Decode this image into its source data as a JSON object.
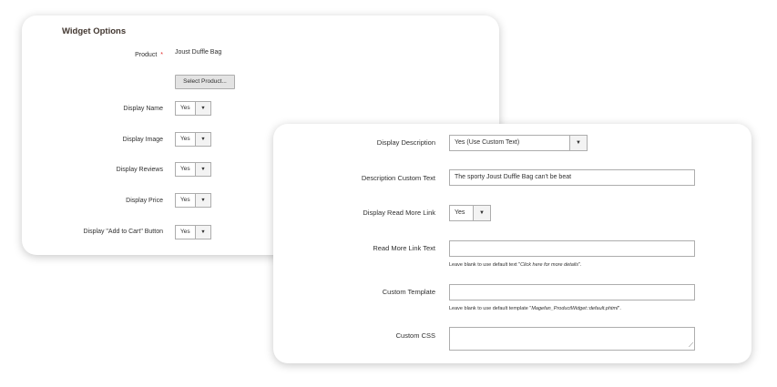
{
  "widget_options": {
    "section_title": "Widget Options",
    "product": {
      "label": "Product",
      "required_mark": "*",
      "value": "Joust Duffle Bag"
    },
    "select_product_button": "Select Product...",
    "display_name": {
      "label": "Display Name",
      "value": "Yes"
    },
    "display_image": {
      "label": "Display Image",
      "value": "Yes"
    },
    "display_reviews": {
      "label": "Display Reviews",
      "value": "Yes"
    },
    "display_price": {
      "label": "Display Price",
      "value": "Yes"
    },
    "display_add_to_cart": {
      "label": "Display \"Add to Cart\" Button",
      "value": "Yes"
    },
    "dropdown_icon": "chevron-down-icon"
  },
  "description_options": {
    "display_description": {
      "label": "Display Description",
      "value": "Yes (Use Custom Text)"
    },
    "description_custom_text": {
      "label": "Description Custom Text",
      "value": "The sporty Joust Duffle Bag can't be beat"
    },
    "display_read_more_link": {
      "label": "Display Read More Link",
      "value": "Yes"
    },
    "read_more_link_text": {
      "label": "Read More Link Text",
      "value": "",
      "note_prefix": "Leave blank to use default text \"",
      "note_default": "Click here for more details",
      "note_suffix": "\"."
    },
    "custom_template": {
      "label": "Custom Template",
      "value": "",
      "note_prefix": "Leave blank to use default template \"",
      "note_default": "Magefan_ProductWidget::default.phtml",
      "note_suffix": "\"."
    },
    "custom_css": {
      "label": "Custom CSS",
      "value": ""
    },
    "resize_icon": "resize-handle-icon"
  }
}
